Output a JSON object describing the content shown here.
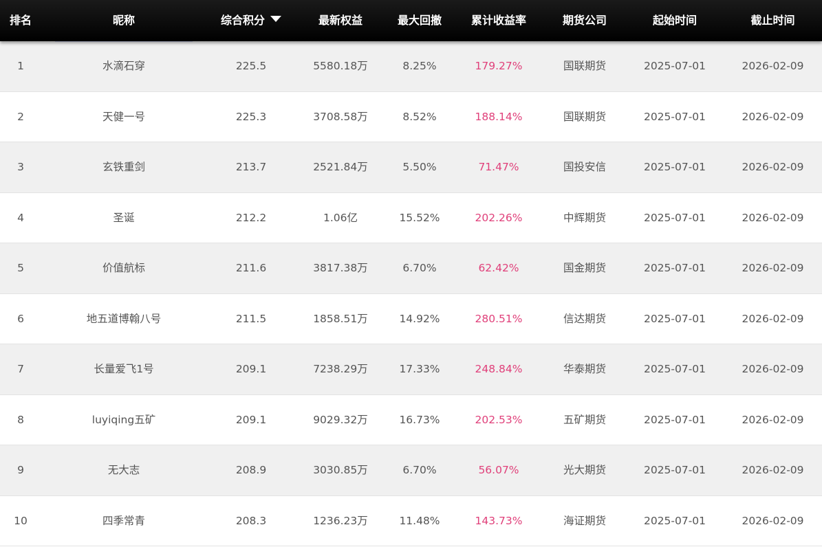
{
  "header": {
    "rank": "排名",
    "nickname": "昵称",
    "score": "综合积分",
    "equity": "最新权益",
    "drawdown": "最大回撤",
    "yield": "累计收益率",
    "company": "期货公司",
    "start": "起始时间",
    "end": "截止时间"
  },
  "rows": [
    {
      "rank": "1",
      "nickname": "水滴石穿",
      "score": "225.5",
      "equity": "5580.18万",
      "drawdown": "8.25%",
      "yield": "179.27%",
      "company": "国联期货",
      "start": "2025-07-01",
      "end": "2026-02-09"
    },
    {
      "rank": "2",
      "nickname": "天健一号",
      "score": "225.3",
      "equity": "3708.58万",
      "drawdown": "8.52%",
      "yield": "188.14%",
      "company": "国联期货",
      "start": "2025-07-01",
      "end": "2026-02-09"
    },
    {
      "rank": "3",
      "nickname": "玄铁重剑",
      "score": "213.7",
      "equity": "2521.84万",
      "drawdown": "5.50%",
      "yield": "71.47%",
      "company": "国投安信",
      "start": "2025-07-01",
      "end": "2026-02-09"
    },
    {
      "rank": "4",
      "nickname": "圣诞",
      "score": "212.2",
      "equity": "1.06亿",
      "drawdown": "15.52%",
      "yield": "202.26%",
      "company": "中辉期货",
      "start": "2025-07-01",
      "end": "2026-02-09"
    },
    {
      "rank": "5",
      "nickname": "价值航标",
      "score": "211.6",
      "equity": "3817.38万",
      "drawdown": "6.70%",
      "yield": "62.42%",
      "company": "国金期货",
      "start": "2025-07-01",
      "end": "2026-02-09"
    },
    {
      "rank": "6",
      "nickname": "地五道博翰八号",
      "score": "211.5",
      "equity": "1858.51万",
      "drawdown": "14.92%",
      "yield": "280.51%",
      "company": "信达期货",
      "start": "2025-07-01",
      "end": "2026-02-09"
    },
    {
      "rank": "7",
      "nickname": "长量爱飞1号",
      "score": "209.1",
      "equity": "7238.29万",
      "drawdown": "17.33%",
      "yield": "248.84%",
      "company": "华泰期货",
      "start": "2025-07-01",
      "end": "2026-02-09"
    },
    {
      "rank": "8",
      "nickname": "luyiqing五矿",
      "score": "209.1",
      "equity": "9029.32万",
      "drawdown": "16.73%",
      "yield": "202.53%",
      "company": "五矿期货",
      "start": "2025-07-01",
      "end": "2026-02-09"
    },
    {
      "rank": "9",
      "nickname": "无大志",
      "score": "208.9",
      "equity": "3030.85万",
      "drawdown": "6.70%",
      "yield": "56.07%",
      "company": "光大期货",
      "start": "2025-07-01",
      "end": "2026-02-09"
    },
    {
      "rank": "10",
      "nickname": "四季常青",
      "score": "208.3",
      "equity": "1236.23万",
      "drawdown": "11.48%",
      "yield": "143.73%",
      "company": "海证期货",
      "start": "2025-07-01",
      "end": "2026-02-09"
    }
  ],
  "colors": {
    "header_bg": "#000000",
    "header_text": "#ffffff",
    "odd_row_bg": "#f0f0f0",
    "even_row_bg": "#ffffff",
    "text": "#555555",
    "yield_text": "#e0407a"
  },
  "sort": {
    "column": "score",
    "direction": "descending",
    "icon": "sort-down-icon"
  }
}
